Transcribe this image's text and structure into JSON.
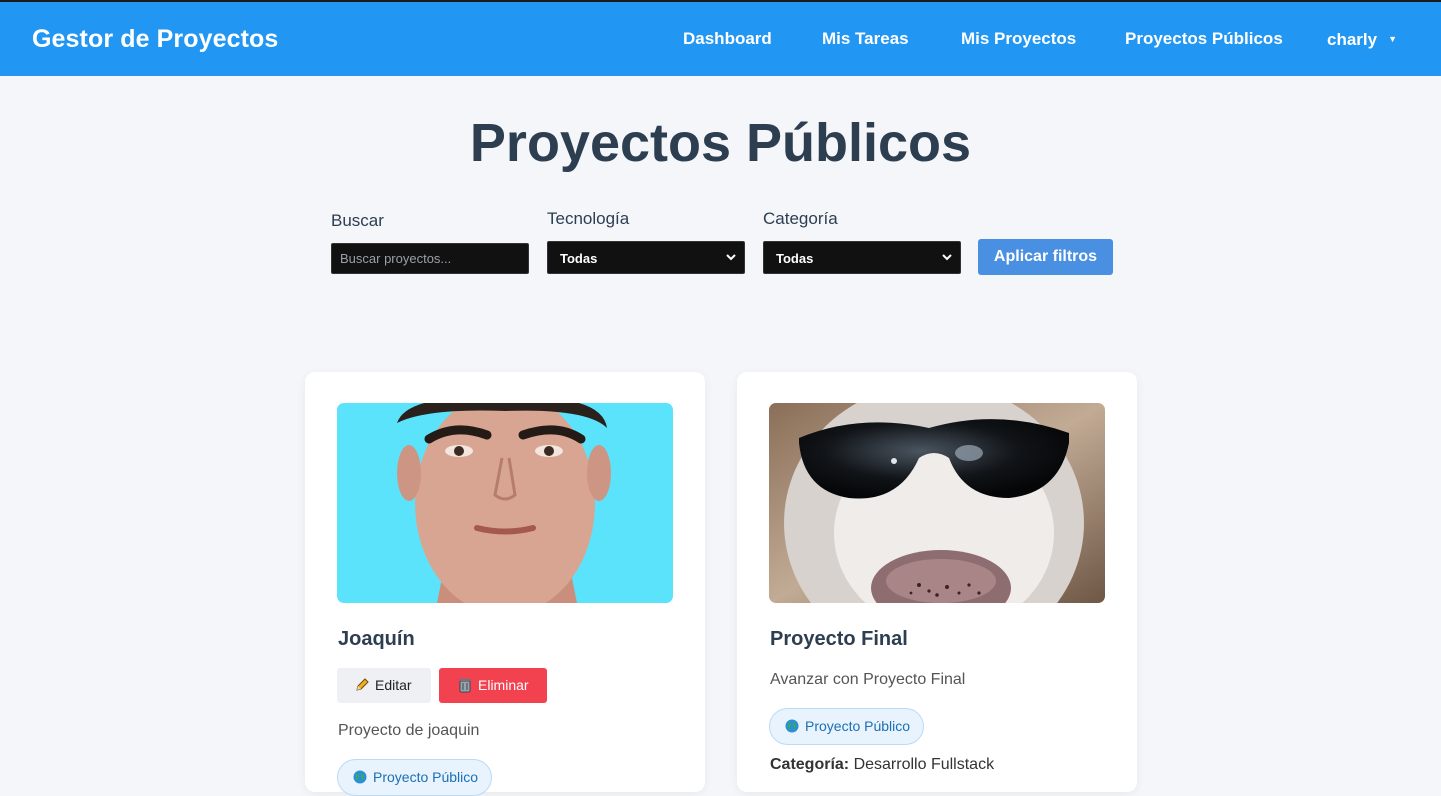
{
  "app": {
    "brand": "Gestor de Proyectos"
  },
  "nav": {
    "items": [
      {
        "label": "Dashboard"
      },
      {
        "label": "Mis Tareas"
      },
      {
        "label": "Mis Proyectos"
      },
      {
        "label": "Proyectos Públicos"
      }
    ],
    "user": "charly"
  },
  "page": {
    "title": "Proyectos Públicos"
  },
  "filters": {
    "search": {
      "label": "Buscar",
      "placeholder": "Buscar proyectos...",
      "value": ""
    },
    "technology": {
      "label": "Tecnología",
      "selected": "Todas"
    },
    "category": {
      "label": "Categoría",
      "selected": "Todas"
    },
    "apply_label": "Aplicar filtros"
  },
  "projects": [
    {
      "title": "Joaquín",
      "edit_label": "Editar",
      "delete_label": "Eliminar",
      "description": "Proyecto de joaquin",
      "badge": "Proyecto Público",
      "image": "portrait photo of young man on cyan background"
    },
    {
      "title": "Proyecto Final",
      "description": "Avanzar con Proyecto Final",
      "badge": "Proyecto Público",
      "category_label": "Categoría:",
      "category_value": "Desarrollo Fullstack",
      "image": "white dog wearing black sunglasses"
    }
  ],
  "colors": {
    "navbar": "#2196f3",
    "apply_button": "#4a90e2",
    "delete_button": "#f2414f",
    "title_text": "#2c3e50",
    "background": "#f4f6fa"
  }
}
